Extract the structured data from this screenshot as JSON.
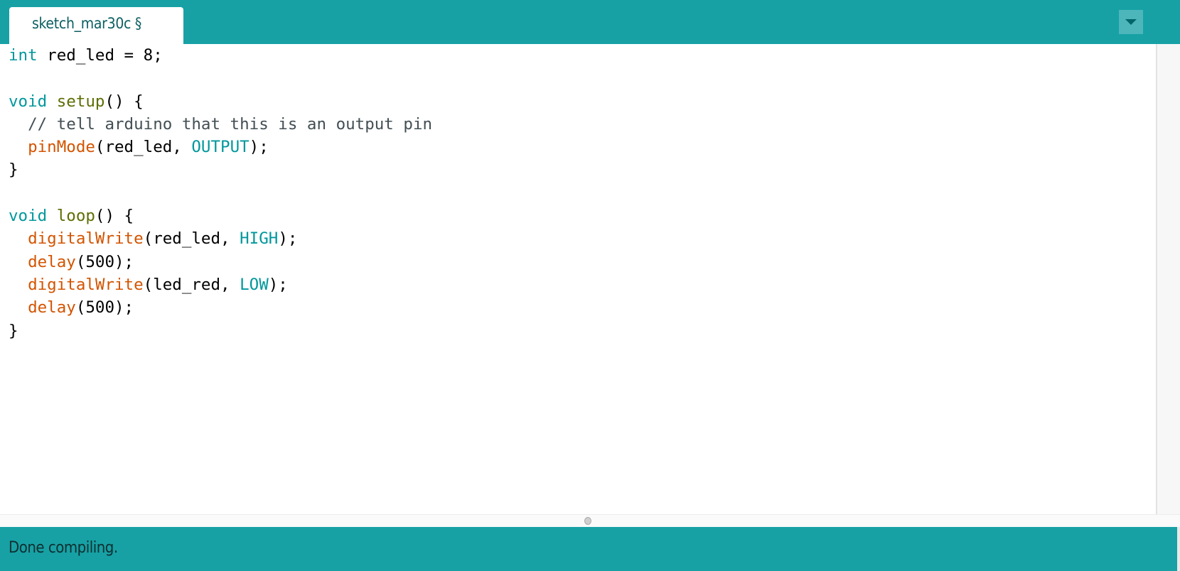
{
  "tab": {
    "label": "sketch_mar30c §"
  },
  "icons": {
    "dropdown": "chevron-down-icon"
  },
  "colors": {
    "brand": "#17a1a5",
    "keyword": "#00979c",
    "function": "#d35400",
    "block": "#5e6d03",
    "comment": "#434f54"
  },
  "code": {
    "l1": {
      "a": "int",
      "b": " red_led = 8;"
    },
    "l3": {
      "a": "void",
      "b": " ",
      "c": "setup",
      "d": "() {"
    },
    "l4": {
      "a": "  // tell arduino that this is an output pin"
    },
    "l5": {
      "a": "  ",
      "b": "pinMode",
      "c": "(red_led, ",
      "d": "OUTPUT",
      "e": ");"
    },
    "l6": {
      "a": "}"
    },
    "l8": {
      "a": "void",
      "b": " ",
      "c": "loop",
      "d": "() {"
    },
    "l9": {
      "a": "  ",
      "b": "digitalWrite",
      "c": "(red_led, ",
      "d": "HIGH",
      "e": ");"
    },
    "l10": {
      "a": "  ",
      "b": "delay",
      "c": "(500);"
    },
    "l11": {
      "a": "  ",
      "b": "digitalWrite",
      "c": "(led_red, ",
      "d": "LOW",
      "e": ");"
    },
    "l12": {
      "a": "  ",
      "b": "delay",
      "c": "(500);"
    },
    "l13": {
      "a": "}"
    }
  },
  "status": {
    "message": "Done compiling."
  }
}
